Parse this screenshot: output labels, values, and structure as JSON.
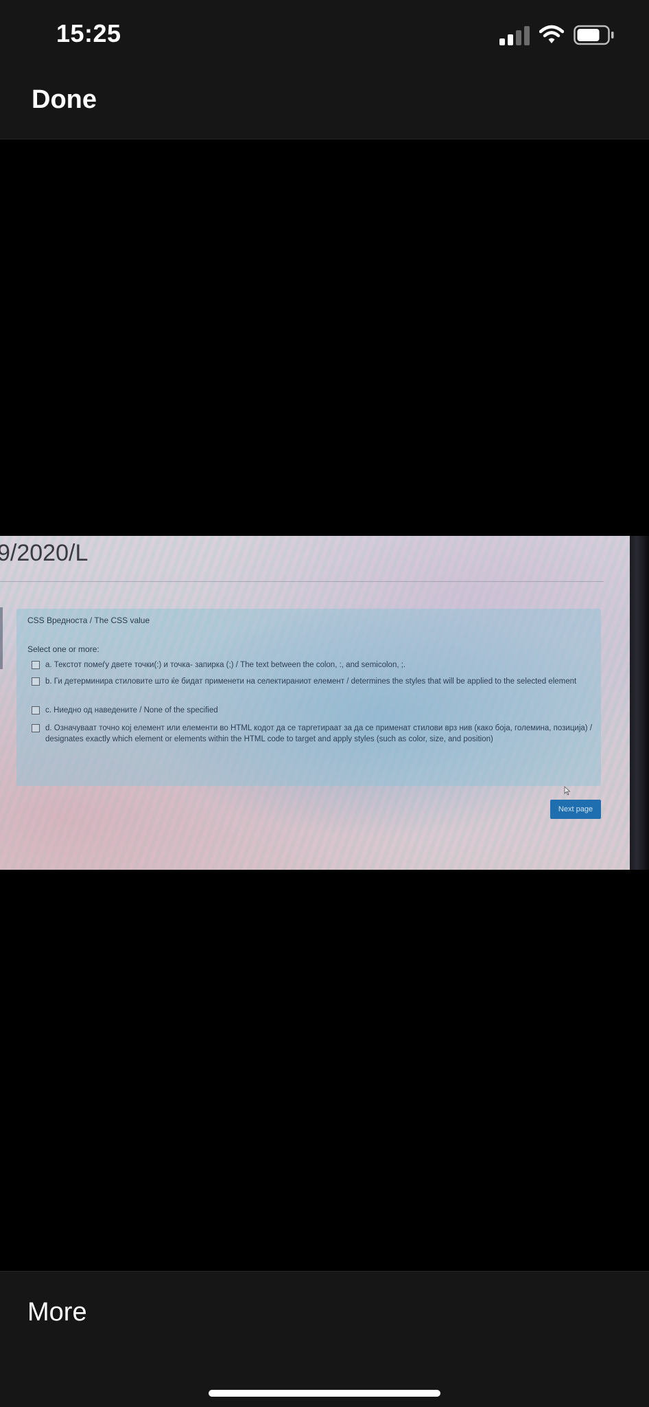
{
  "status_bar": {
    "time": "15:25",
    "signal_icon": "cellular-signal-icon",
    "wifi_icon": "wifi-icon",
    "battery_icon": "battery-icon",
    "signal_bars_filled": 2,
    "signal_bars_total": 4,
    "battery_level": 0.75
  },
  "header": {
    "done_label": "Done"
  },
  "photo": {
    "course_title": "9/2020/L",
    "question_title": "CSS Вредноста / The CSS value",
    "select_label": "Select one or more:",
    "options": [
      {
        "label": "a. Текстот помеѓу двете точки(:) и точка- запирка (;) / The text between the colon, :, and semicolon, ;."
      },
      {
        "label": "b. Ги детерминира стиловите што ќе бидат применети на селектираниот елемент / determines the styles that will be applied to the selected element"
      },
      {
        "label": "c. Ниедно од наведените / None of the specified"
      },
      {
        "label": "d. Означуваат точно кој елемент или елементи во HTML кодот да се таргетираат за да се применат стилови врз нив (како боја, големина, позиција) / designates exactly which element or elements within the HTML code to target and apply styles (such as color, size, and position)"
      }
    ],
    "next_label": "Next page"
  },
  "footer": {
    "more_label": "More"
  },
  "colors": {
    "bar_background": "#161616",
    "accent_button": "#1f6fb0",
    "panel": "#8cc3d7"
  }
}
